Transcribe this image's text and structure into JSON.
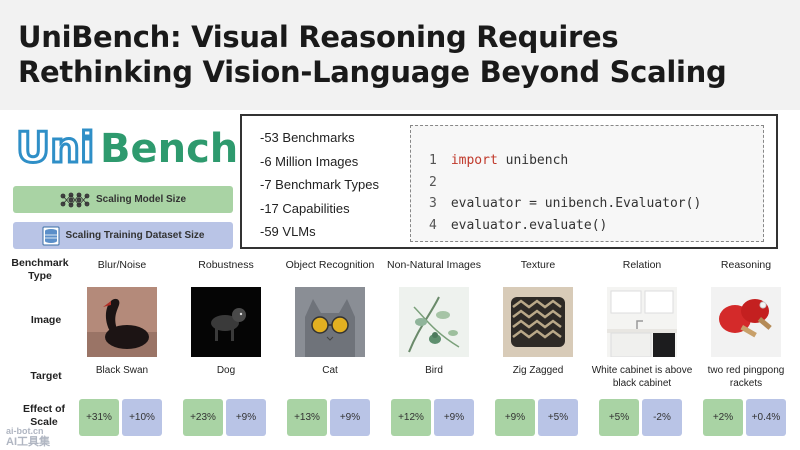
{
  "title": "UniBench: Visual Reasoning Requires Rethinking Vision-Language Beyond Scaling",
  "logo": {
    "text_uni": "Uni",
    "text_bench": "Bench",
    "colors": {
      "uni": "#2f8fc7",
      "bench": "#2e9a6e"
    }
  },
  "buttons": {
    "scaling_model": "Scaling Model Size",
    "scaling_data": "Scaling Training Dataset Size"
  },
  "stats": [
    "-53 Benchmarks",
    "-6 Million Images",
    "-7 Benchmark Types",
    "-17 Capabilities",
    "-59 VLMs"
  ],
  "code": {
    "lines": [
      {
        "n": "1",
        "kw": "import",
        "rest": " unibench"
      },
      {
        "n": "2",
        "kw": "",
        "rest": ""
      },
      {
        "n": "3",
        "kw": "",
        "rest": "evaluator = unibench.Evaluator()"
      },
      {
        "n": "4",
        "kw": "",
        "rest": "evaluator.evaluate()"
      }
    ]
  },
  "row_labels": {
    "type": "Benchmark Type",
    "image": "Image",
    "target": "Target",
    "effect": "Effect of Scale"
  },
  "columns": [
    {
      "type": "Blur/Noise",
      "target": "Black Swan",
      "model": "+31%",
      "data": "+10%",
      "icon": "swan-image"
    },
    {
      "type": "Robustness",
      "target": "Dog",
      "model": "+23%",
      "data": "+9%",
      "icon": "dog-image"
    },
    {
      "type": "Object Recognition",
      "target": "Cat",
      "model": "+13%",
      "data": "+9%",
      "icon": "cat-image"
    },
    {
      "type": "Non-Natural Images",
      "target": "Bird",
      "model": "+12%",
      "data": "+9%",
      "icon": "bird-image"
    },
    {
      "type": "Texture",
      "target": "Zig Zagged",
      "model": "+9%",
      "data": "+5%",
      "icon": "pillow-image"
    },
    {
      "type": "Relation",
      "target": "White cabinet is above black cabinet",
      "model": "+5%",
      "data": "-2%",
      "icon": "kitchen-image"
    },
    {
      "type": "Reasoning",
      "target": "two red pingpong rackets",
      "model": "+2%",
      "data": "+0.4%",
      "icon": "rackets-image"
    }
  ],
  "watermark": {
    "line1": "ai-bot.cn",
    "line2": "AI工具集"
  },
  "colors": {
    "green": "#a9d3a4",
    "blue": "#b9c4e6"
  }
}
